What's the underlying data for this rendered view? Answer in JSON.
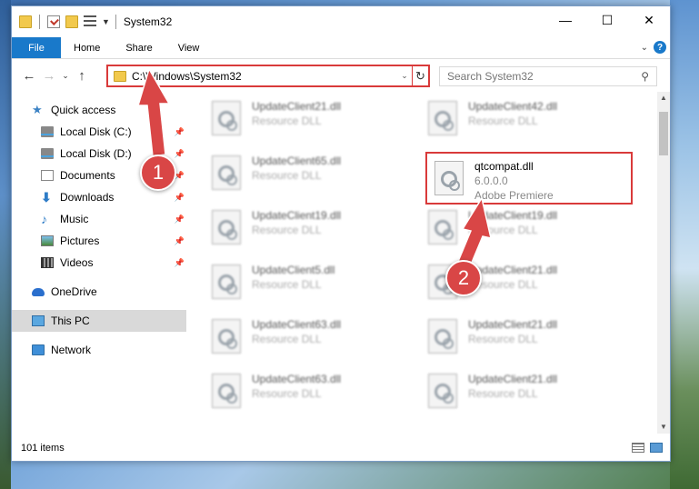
{
  "window": {
    "title": "System32",
    "controls": {
      "minimize": "—",
      "maximize": "☐",
      "close": "✕"
    }
  },
  "ribbon": {
    "tabs": [
      "File",
      "Home",
      "Share",
      "View"
    ],
    "help": "?"
  },
  "nav": {
    "address": "C:\\Windows\\System32",
    "search_placeholder": "Search System32"
  },
  "sidebar": {
    "items": [
      {
        "label": "Quick access",
        "icon": "star-icon",
        "pinned": false
      },
      {
        "label": "Local Disk (C:)",
        "icon": "disk-icon",
        "pinned": true
      },
      {
        "label": "Local Disk (D:)",
        "icon": "disk-icon",
        "pinned": true
      },
      {
        "label": "Documents",
        "icon": "documents-icon",
        "pinned": true
      },
      {
        "label": "Downloads",
        "icon": "download-icon",
        "pinned": true
      },
      {
        "label": "Music",
        "icon": "music-icon",
        "pinned": true
      },
      {
        "label": "Pictures",
        "icon": "pictures-icon",
        "pinned": true
      },
      {
        "label": "Videos",
        "icon": "videos-icon",
        "pinned": true
      },
      {
        "label": "OneDrive",
        "icon": "onedrive-icon",
        "pinned": false
      },
      {
        "label": "This PC",
        "icon": "this-pc-icon",
        "pinned": false,
        "selected": true
      },
      {
        "label": "Network",
        "icon": "network-icon",
        "pinned": false
      }
    ]
  },
  "files": {
    "left_column": [
      {
        "name": "UpdateClient21.dll",
        "desc": "Resource DLL"
      },
      {
        "name": "UpdateClient65.dll",
        "desc": "Resource DLL"
      },
      {
        "name": "UpdateClient19.dll",
        "desc": "Resource DLL"
      },
      {
        "name": "UpdateClient5.dll",
        "desc": "Resource DLL"
      },
      {
        "name": "UpdateClient63.dll",
        "desc": "Resource DLL"
      },
      {
        "name": "UpdateClient63.dll",
        "desc": "Resource DLL"
      }
    ],
    "right_column": [
      {
        "name": "UpdateClient42.dll",
        "desc": "Resource DLL"
      },
      {
        "name": "UpdateClient19.dll",
        "desc": "Resource DLL"
      },
      {
        "name": "UpdateClient21.dll",
        "desc": "Resource DLL"
      },
      {
        "name": "UpdateClient21.dll",
        "desc": "Resource DLL"
      },
      {
        "name": "UpdateClient21.dll",
        "desc": "Resource DLL"
      }
    ],
    "highlighted": {
      "name": "qtcompat.dll",
      "version": "6.0.0.0",
      "company": "Adobe Premiere"
    }
  },
  "status": {
    "item_count": "101 items"
  },
  "callouts": [
    "1",
    "2"
  ],
  "colors": {
    "accent": "#1979ca",
    "highlight_red": "#d93a3a"
  }
}
